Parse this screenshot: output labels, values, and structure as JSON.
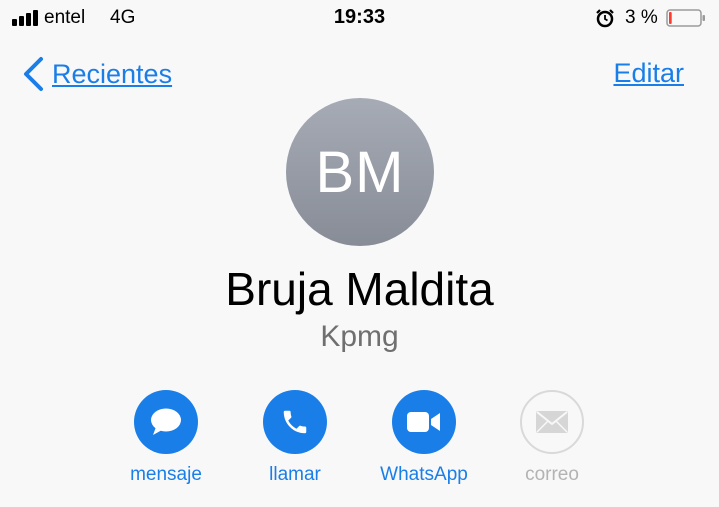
{
  "status_bar": {
    "carrier": "entel",
    "network": "4G",
    "time": "19:33",
    "battery_percent": "3 %",
    "battery_level": 0.03,
    "icons": [
      "signal-icon",
      "alarm-icon",
      "battery-icon"
    ]
  },
  "nav": {
    "back_label": "Recientes",
    "edit_label": "Editar"
  },
  "contact": {
    "initials": "BM",
    "name": "Bruja Maldita",
    "company": "Kpmg"
  },
  "actions": [
    {
      "label": "mensaje",
      "icon": "message-icon",
      "enabled": true
    },
    {
      "label": "llamar",
      "icon": "phone-icon",
      "enabled": true
    },
    {
      "label": "WhatsApp",
      "icon": "video-icon",
      "enabled": true
    },
    {
      "label": "correo",
      "icon": "mail-icon",
      "enabled": false
    }
  ],
  "colors": {
    "accent": "#1a7ee8",
    "disabled": "#b3b3b3",
    "battery_low": "#ff3b30"
  }
}
